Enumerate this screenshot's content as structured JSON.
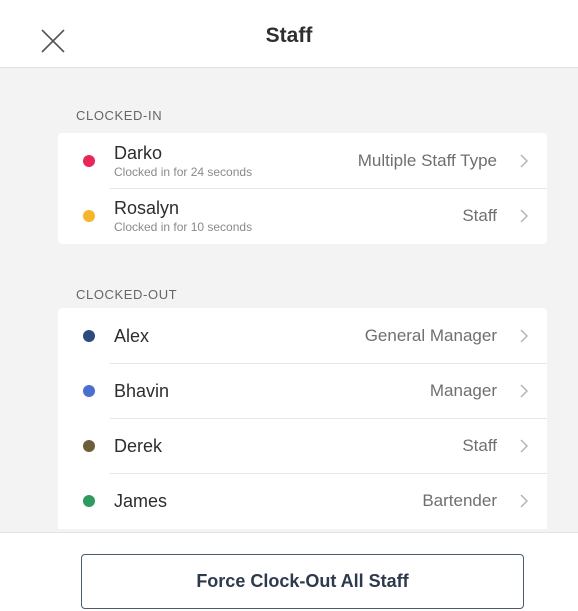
{
  "header": {
    "title": "Staff",
    "close_icon": "close-icon"
  },
  "clocked_in": {
    "label": "CLOCKED-IN",
    "items": [
      {
        "name": "Darko",
        "status": "Clocked in for 24 seconds",
        "role": "Multiple Staff Type",
        "color": "#e8265a"
      },
      {
        "name": "Rosalyn",
        "status": "Clocked in for 10 seconds",
        "role": "Staff",
        "color": "#f7b52c"
      }
    ]
  },
  "clocked_out": {
    "label": "CLOCKED-OUT",
    "items": [
      {
        "name": "Alex",
        "role": "General Manager",
        "color": "#2e4a7d"
      },
      {
        "name": "Bhavin",
        "role": "Manager",
        "color": "#4a6fd0"
      },
      {
        "name": "Derek",
        "role": "Staff",
        "color": "#6b5f3a"
      },
      {
        "name": "James",
        "role": "Bartender",
        "color": "#2e9a5e"
      }
    ]
  },
  "footer": {
    "force_button_label": "Force Clock-Out All Staff"
  },
  "icons": {
    "row_chevron": "chevron-right-icon",
    "status_dot": "status-dot-icon"
  }
}
